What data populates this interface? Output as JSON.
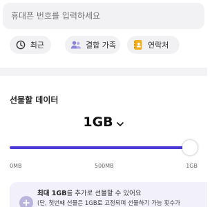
{
  "phone_input": {
    "placeholder": "휴대폰 번호를 입력하세요",
    "value": ""
  },
  "chips": [
    {
      "label": "최근",
      "icon": "clock-icon"
    },
    {
      "label": "결합 가족",
      "icon": "people-icon"
    },
    {
      "label": "연락처",
      "icon": "contacts-book-icon"
    }
  ],
  "gift": {
    "title": "선물할 데이터",
    "amount": "1GB",
    "slider": {
      "min_label": "0MB",
      "mid_label": "500MB",
      "max_label": "1GB",
      "fraction": 1.0
    }
  },
  "info": {
    "line1_bold": "최대 1GB",
    "line1_rest": "를 추가로 선물할 수 있어요",
    "line2": "(단, 첫번째 선물은 1GB로 고정되며 선물하기 가능 횟수가"
  },
  "colors": {
    "accent": "#4b3ad3",
    "chip_bg": "#f1f1f3",
    "info_bg": "#f2f1fb",
    "family_icon": "#8c84d9",
    "contacts_icon": "#f2b01e"
  }
}
